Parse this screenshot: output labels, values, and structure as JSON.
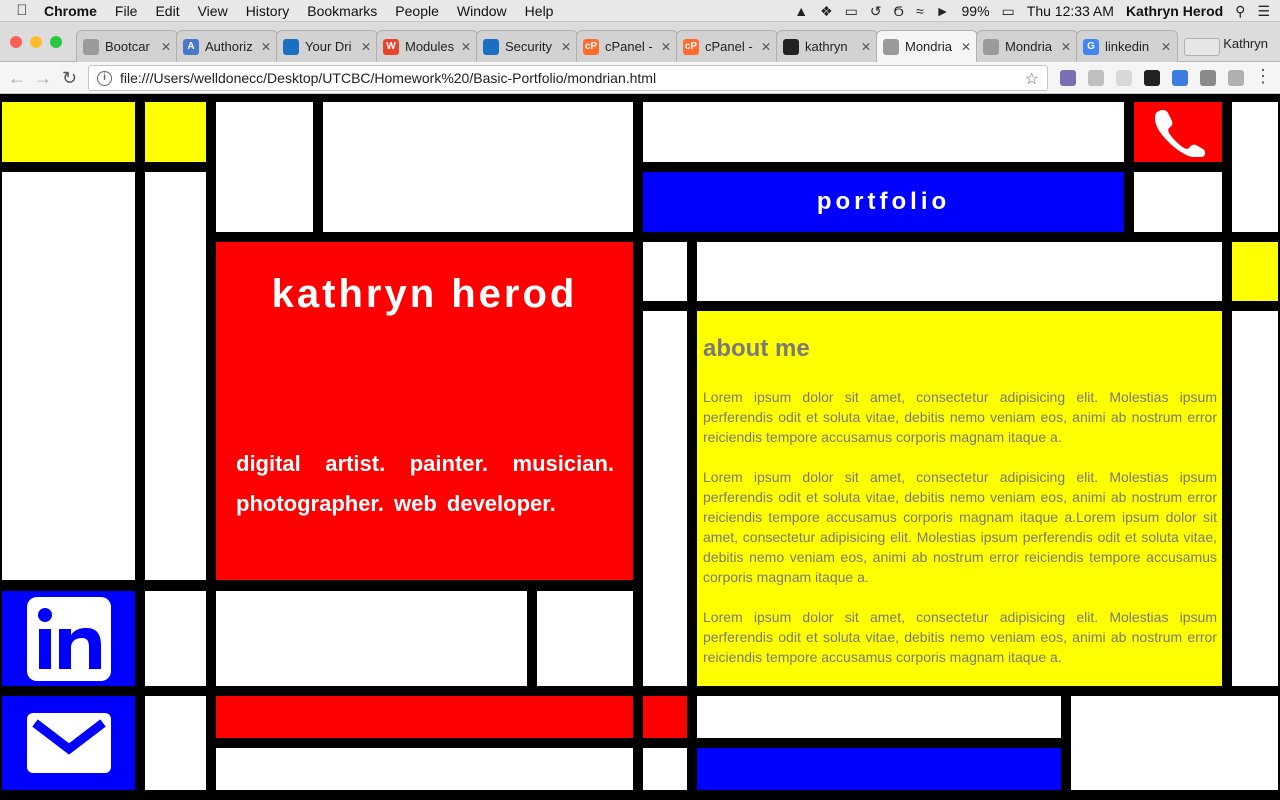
{
  "menubar": {
    "app": "Chrome",
    "items": [
      "File",
      "Edit",
      "View",
      "History",
      "Bookmarks",
      "People",
      "Window",
      "Help"
    ],
    "battery": "99%",
    "clock": "Thu 12:33 AM",
    "user": "Kathryn Herod"
  },
  "tabs": [
    {
      "label": "Bootcar",
      "icon": "document-icon"
    },
    {
      "label": "Authoriz",
      "icon": "app-icon"
    },
    {
      "label": "Your Dri",
      "icon": "drupal-icon"
    },
    {
      "label": "Modules",
      "icon": "w-icon"
    },
    {
      "label": "Security",
      "icon": "drupal-icon"
    },
    {
      "label": "cPanel -",
      "icon": "cpanel-icon"
    },
    {
      "label": "cPanel -",
      "icon": "cpanel-icon"
    },
    {
      "label": "kathryn",
      "icon": "github-icon"
    },
    {
      "label": "Mondria",
      "icon": "document-icon"
    },
    {
      "label": "Mondria",
      "icon": "document-icon"
    },
    {
      "label": "linkedin",
      "icon": "google-icon"
    }
  ],
  "profile_name": "Kathryn",
  "address": {
    "url": "file:///Users/welldonecc/Desktop/UTCBC/Homework%20/Basic-Portfolio/mondrian.html"
  },
  "page": {
    "portfolio_label": "portfolio",
    "name": "kathryn herod",
    "tagline": "digital artist. painter. musician. photographer. web developer.",
    "about": {
      "title": "about me",
      "paragraphs": [
        "Lorem ipsum dolor sit amet, consectetur adipisicing elit. Molestias ipsum perferendis odit et soluta vitae, debitis nemo veniam eos, animi ab nostrum error reiciendis tempore accusamus corporis magnam itaque a.",
        "Lorem ipsum dolor sit amet, consectetur adipisicing elit. Molestias ipsum perferendis odit et soluta vitae, debitis nemo veniam eos, animi ab nostrum error reiciendis tempore accusamus corporis magnam itaque a.Lorem ipsum dolor sit amet, consectetur adipisicing elit. Molestias ipsum perferendis odit et soluta vitae, debitis nemo veniam eos, animi ab nostrum error reiciendis tempore accusamus corporis magnam itaque a.",
        "Lorem ipsum dolor sit amet, consectetur adipisicing elit. Molestias ipsum perferendis odit et soluta vitae, debitis nemo veniam eos, animi ab nostrum error reiciendis tempore accusamus corporis magnam itaque a."
      ]
    },
    "icons": {
      "phone": "phone-icon",
      "linkedin": "linkedin-icon",
      "mail": "mail-icon"
    },
    "colors": {
      "yellow": "#ffff00",
      "red": "#ff0000",
      "blue": "#0000ff",
      "white": "#ffffff",
      "black": "#000000"
    }
  }
}
